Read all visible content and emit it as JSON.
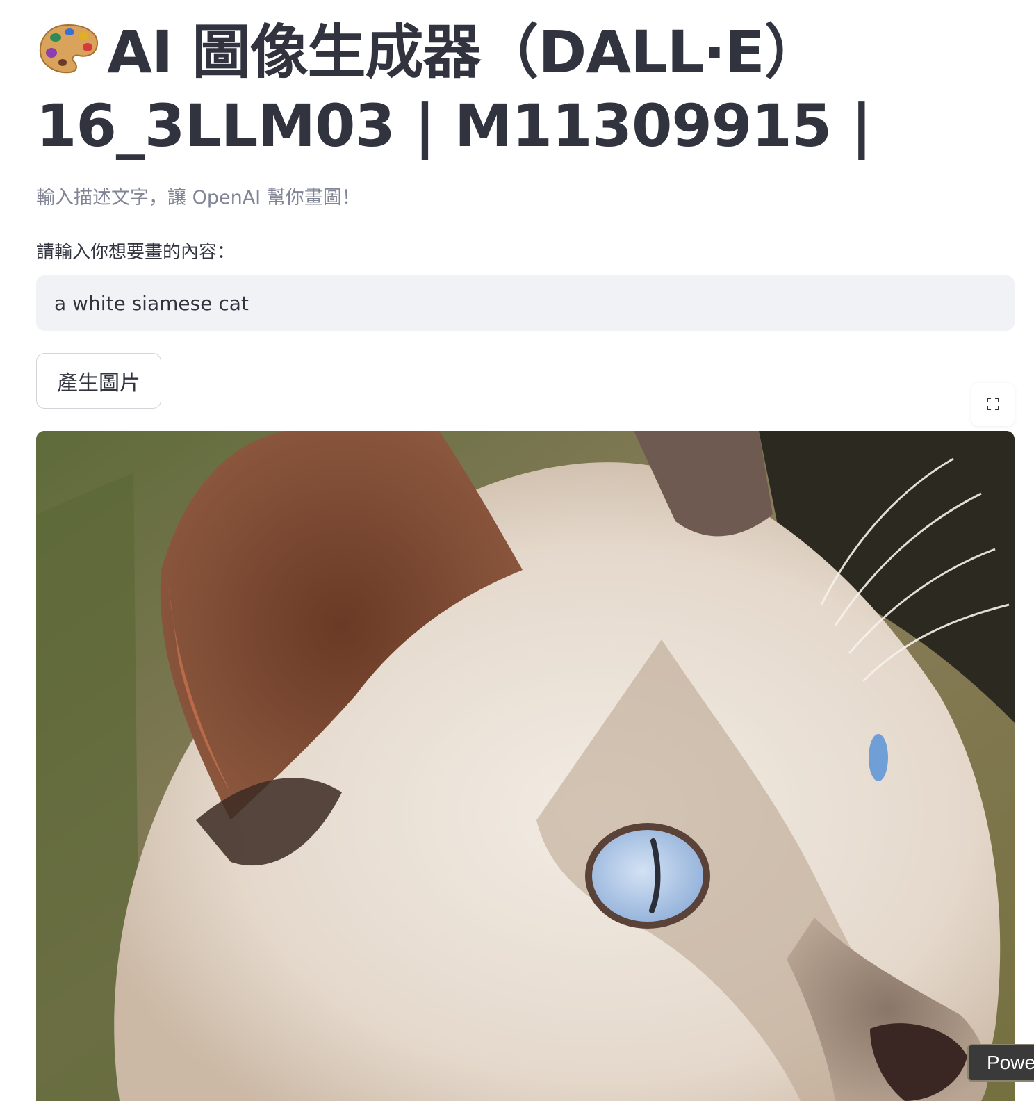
{
  "header": {
    "title_line1": "AI 圖像生成器（DALL·E）",
    "title_line2": "16_3LLM03 | M11309915 |",
    "title_icon": "artist-palette-icon"
  },
  "subtitle": "輸入描述文字，讓 OpenAI 幫你畫圖！",
  "prompt": {
    "label": "請輸入你想要畫的內容：",
    "value": "a white siamese cat"
  },
  "generate_button": {
    "label": "產生圖片"
  },
  "toolbar": {
    "fullscreen_icon": "fullscreen-icon"
  },
  "generated_image": {
    "description_icon": "generated-image",
    "colors": {
      "fur_light": "#efe6dc",
      "fur_brown": "#7a4a32",
      "eye_blue": "#aac4e6",
      "background_green": "#6d7a44"
    }
  },
  "badge": {
    "label": "Powe"
  }
}
